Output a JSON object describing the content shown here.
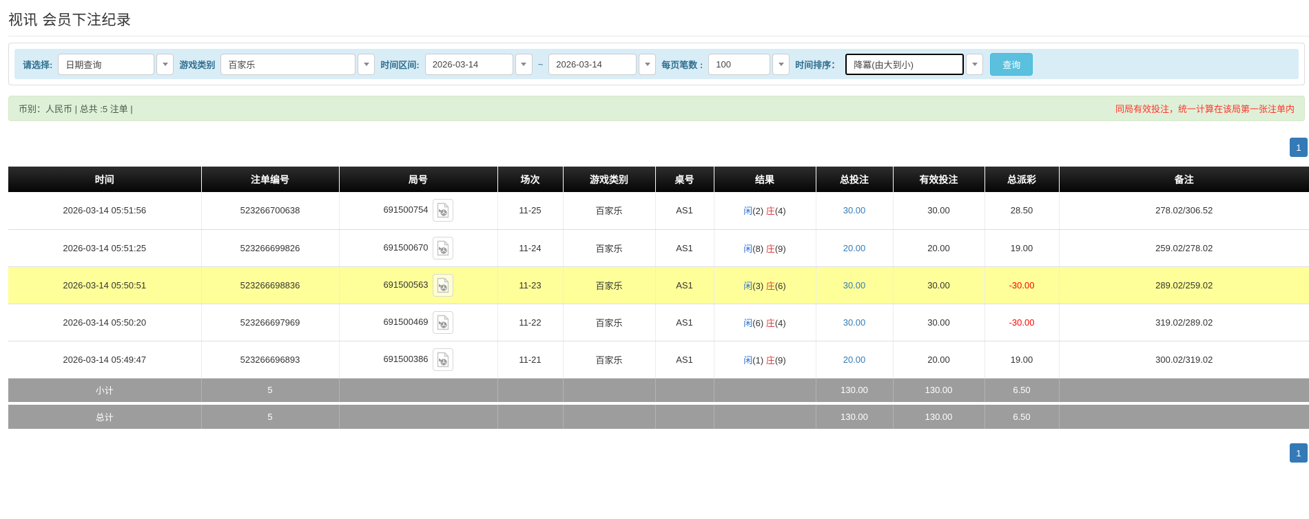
{
  "page": {
    "title": "视讯 会员下注纪录"
  },
  "filters": {
    "select_label": "请选择:",
    "select_value": "日期查询",
    "game_type_label": "游戏类别",
    "game_type_value": "百家乐",
    "time_range_label": "时间区间:",
    "date_from": "2026-03-14",
    "tilde": "~",
    "date_to": "2026-03-14",
    "page_size_label": "每页笔数 :",
    "page_size_value": "100",
    "sort_label": "时间排序：",
    "sort_value": "降冪(由大到小)",
    "search_button": "查询"
  },
  "summary": {
    "left_text": "币别：人民币 | 总共 :5 注单 |",
    "right_note": "同局有效投注，统一计算在该局第一张注单内"
  },
  "pagination": {
    "page": "1"
  },
  "icons": {
    "combo_caret": "chevron-down",
    "round_video": "video-record-file"
  },
  "colors": {
    "filter_bar_bg": "#d9edf7",
    "filter_label": "#31708f",
    "search_button": "#5bc0de",
    "summary_bg": "#dff0d8",
    "summary_note_red": "#ff342b",
    "header_bg": "#111111",
    "link_blue": "#337ab7",
    "player_blue": "#2f6fd0",
    "banker_red": "#dd3e3e",
    "negative_red": "#ff0000",
    "highlight_row": "#ffff99",
    "footer_gray": "#9d9d9d",
    "pager_active": "#337ab7"
  },
  "table": {
    "headers": [
      "时间",
      "注单编号",
      "局号",
      "场次",
      "游戏类别",
      "桌号",
      "结果",
      "总投注",
      "有效投注",
      "总派彩",
      "备注"
    ],
    "rows": [
      {
        "time": "2026-03-14 05:51:56",
        "bet_no": "523266700638",
        "round_no": "691500754",
        "session": "11-25",
        "game": "百家乐",
        "table_no": "AS1",
        "result": {
          "player": "闲",
          "player_num": "(2)",
          "banker": "庄",
          "banker_num": "(4)"
        },
        "total_bet": "30.00",
        "valid_bet": "30.00",
        "payout": "28.50",
        "payout_negative": false,
        "remark": "278.02/306.52",
        "highlight": false
      },
      {
        "time": "2026-03-14 05:51:25",
        "bet_no": "523266699826",
        "round_no": "691500670",
        "session": "11-24",
        "game": "百家乐",
        "table_no": "AS1",
        "result": {
          "player": "闲",
          "player_num": "(8)",
          "banker": "庄",
          "banker_num": "(9)"
        },
        "total_bet": "20.00",
        "valid_bet": "20.00",
        "payout": "19.00",
        "payout_negative": false,
        "remark": "259.02/278.02",
        "highlight": false
      },
      {
        "time": "2026-03-14 05:50:51",
        "bet_no": "523266698836",
        "round_no": "691500563",
        "session": "11-23",
        "game": "百家乐",
        "table_no": "AS1",
        "result": {
          "player": "闲",
          "player_num": "(3)",
          "banker": "庄",
          "banker_num": "(6)"
        },
        "total_bet": "30.00",
        "valid_bet": "30.00",
        "payout": "-30.00",
        "payout_negative": true,
        "remark": "289.02/259.02",
        "highlight": true
      },
      {
        "time": "2026-03-14 05:50:20",
        "bet_no": "523266697969",
        "round_no": "691500469",
        "session": "11-22",
        "game": "百家乐",
        "table_no": "AS1",
        "result": {
          "player": "闲",
          "player_num": "(6)",
          "banker": "庄",
          "banker_num": "(4)"
        },
        "total_bet": "30.00",
        "valid_bet": "30.00",
        "payout": "-30.00",
        "payout_negative": true,
        "remark": "319.02/289.02",
        "highlight": false
      },
      {
        "time": "2026-03-14 05:49:47",
        "bet_no": "523266696893",
        "round_no": "691500386",
        "session": "11-21",
        "game": "百家乐",
        "table_no": "AS1",
        "result": {
          "player": "闲",
          "player_num": "(1)",
          "banker": "庄",
          "banker_num": "(9)"
        },
        "total_bet": "20.00",
        "valid_bet": "20.00",
        "payout": "19.00",
        "payout_negative": false,
        "remark": "300.02/319.02",
        "highlight": false
      }
    ],
    "footer": [
      {
        "label": "小计",
        "count": "5",
        "total_bet": "130.00",
        "valid_bet": "130.00",
        "payout": "6.50"
      },
      {
        "label": "总计",
        "count": "5",
        "total_bet": "130.00",
        "valid_bet": "130.00",
        "payout": "6.50"
      }
    ]
  }
}
